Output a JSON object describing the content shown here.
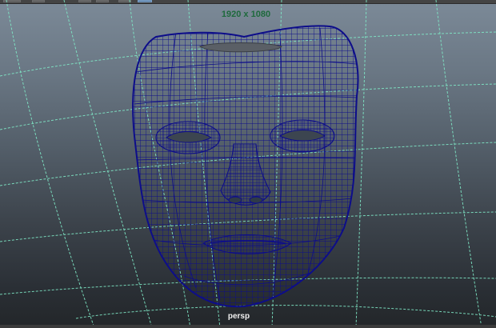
{
  "viewport": {
    "resolution_gate": "1920 x 1080",
    "camera_name": "persp"
  },
  "colors": {
    "grid_line": "#7fe8c6",
    "wireframe": "#0d0d8a",
    "resolution_text": "#1e6a3c"
  },
  "icons": [
    "toolbar-button"
  ]
}
